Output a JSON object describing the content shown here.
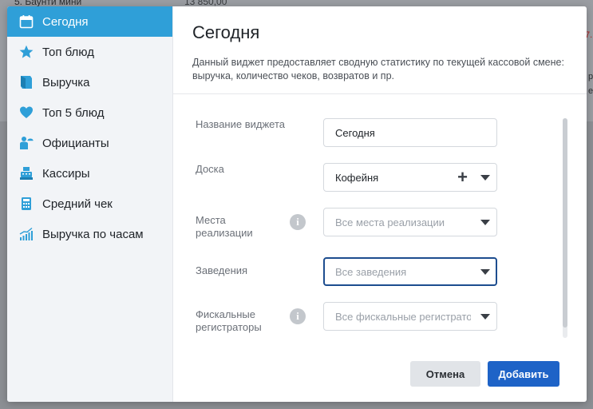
{
  "background": {
    "text1": "5. Баунти мини",
    "text2": "13 850,00",
    "text3": "7.",
    "text4": "р",
    "text5": "е"
  },
  "sidebar": {
    "items": [
      {
        "label": "Сегодня",
        "icon": "calendar-icon",
        "active": true
      },
      {
        "label": "Топ блюд",
        "icon": "star-icon",
        "active": false
      },
      {
        "label": "Выручка",
        "icon": "receipt-icon",
        "active": false
      },
      {
        "label": "Топ 5 блюд",
        "icon": "heart-icon",
        "active": false
      },
      {
        "label": "Официанты",
        "icon": "waiter-icon",
        "active": false
      },
      {
        "label": "Кассиры",
        "icon": "cash-register-icon",
        "active": false
      },
      {
        "label": "Средний чек",
        "icon": "calculator-icon",
        "active": false
      },
      {
        "label": "Выручка по часам",
        "icon": "bar-chart-icon",
        "active": false
      }
    ]
  },
  "main": {
    "title": "Сегодня",
    "description": "Данный виджет предоставляет сводную статистику по текущей кассовой смене: выручка, количество чеков, возвратов и пр."
  },
  "form": {
    "widget_name": {
      "label": "Название виджета",
      "value": "Сегодня"
    },
    "board": {
      "label": "Доска",
      "value": "Кофейня"
    },
    "places": {
      "label": "Места реализации",
      "placeholder": "Все места реализации"
    },
    "establishments": {
      "label": "Заведения",
      "placeholder": "Все заведения"
    },
    "fiscal": {
      "label": "Фискальные регистраторы",
      "placeholder": "Все фискальные регистраторы"
    }
  },
  "buttons": {
    "cancel": "Отмена",
    "add": "Добавить"
  },
  "colors": {
    "accent": "#2f9fd8",
    "primary_button": "#1e63c7",
    "icon": "#2f9fd8"
  }
}
